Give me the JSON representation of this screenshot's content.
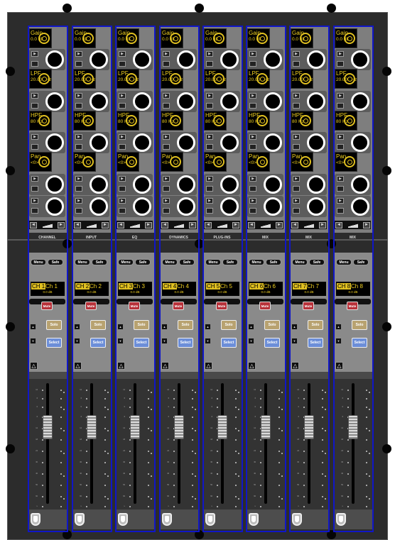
{
  "colors": {
    "accent_yellow": "#f0d020",
    "strip_outline": "#1016c8",
    "mute": "#b8323a",
    "solo": "#b8a270",
    "select": "#6c8ed8",
    "frame": "#2c2c2c"
  },
  "icons": {
    "pan_left": "◄",
    "pan_right": "►",
    "attention": "△",
    "up": "▲",
    "down": "▼"
  },
  "strips": [
    {
      "section_label": "CHANNEL",
      "ch_num": "CH 1",
      "ch_name": "Ch 1",
      "gain_label": "Gain",
      "gain_value": "0.0 dB",
      "lpf_label": "LPF",
      "lpf_value": "20.00 kHz",
      "hpf_label": "HPF",
      "hpf_value": "80 Hz",
      "pan_label": "Pan",
      "pan_value": "<0>",
      "menu": "Menu",
      "safe": "Safe",
      "fader_db": "0.0 dB",
      "mute": "Mute",
      "solo": "Solo",
      "select": "Select"
    },
    {
      "section_label": "INPUT",
      "ch_num": "CH 2",
      "ch_name": "Ch 2",
      "gain_label": "Gain",
      "gain_value": "0.0 dB",
      "lpf_label": "LPF",
      "lpf_value": "20.00 kHz",
      "hpf_label": "HPF",
      "hpf_value": "80 Hz",
      "pan_label": "Pan",
      "pan_value": "<0>",
      "menu": "Menu",
      "safe": "Safe",
      "fader_db": "0.0 dB",
      "mute": "Mute",
      "solo": "Solo",
      "select": "Select"
    },
    {
      "section_label": "EQ",
      "ch_num": "CH 3",
      "ch_name": "Ch 3",
      "gain_label": "Gain",
      "gain_value": "0.0 dB",
      "lpf_label": "LPF",
      "lpf_value": "20.00 kHz",
      "hpf_label": "HPF",
      "hpf_value": "80 Hz",
      "pan_label": "Pan",
      "pan_value": "<0>",
      "menu": "Menu",
      "safe": "Safe",
      "fader_db": "0.0 dB",
      "mute": "Mute",
      "solo": "Solo",
      "select": "Select"
    },
    {
      "section_label": "DYNAMICS",
      "ch_num": "CH 4",
      "ch_name": "Ch 4",
      "gain_label": "Gain",
      "gain_value": "0.0 dB",
      "lpf_label": "LPF",
      "lpf_value": "20.00 kHz",
      "hpf_label": "HPF",
      "hpf_value": "80 Hz",
      "pan_label": "Pan",
      "pan_value": "<0>",
      "menu": "Menu",
      "safe": "Safe",
      "fader_db": "0.0 dB",
      "mute": "Mute",
      "solo": "Solo",
      "select": "Select"
    },
    {
      "section_label": "PLUG-INS",
      "ch_num": "CH 5",
      "ch_name": "Ch 5",
      "gain_label": "Gain",
      "gain_value": "0.0 dB",
      "lpf_label": "LPF",
      "lpf_value": "20.00 kHz",
      "hpf_label": "HPF",
      "hpf_value": "80 Hz",
      "pan_label": "Pan",
      "pan_value": "<0>",
      "menu": "Menu",
      "safe": "Safe",
      "fader_db": "0.0 dB",
      "mute": "Mute",
      "solo": "Solo",
      "select": "Select"
    },
    {
      "section_label": "MIX",
      "ch_num": "CH 6",
      "ch_name": "Ch 6",
      "gain_label": "Gain",
      "gain_value": "0.0 dB",
      "lpf_label": "LPF",
      "lpf_value": "20.00 kHz",
      "hpf_label": "HPF",
      "hpf_value": "80 Hz",
      "pan_label": "Pan",
      "pan_value": "<0>",
      "menu": "Menu",
      "safe": "Safe",
      "fader_db": "0.0 dB",
      "mute": "Mute",
      "solo": "Solo",
      "select": "Select"
    },
    {
      "section_label": "MIX",
      "ch_num": "CH 7",
      "ch_name": "Ch 7",
      "gain_label": "Gain",
      "gain_value": "0.0 dB",
      "lpf_label": "LPF",
      "lpf_value": "20.00 kHz",
      "hpf_label": "HPF",
      "hpf_value": "80 Hz",
      "pan_label": "Pan",
      "pan_value": "<0>",
      "menu": "Menu",
      "safe": "Safe",
      "fader_db": "0.0 dB",
      "mute": "Mute",
      "solo": "Solo",
      "select": "Select"
    },
    {
      "section_label": "MIX",
      "ch_num": "CH 8",
      "ch_name": "Ch 8",
      "gain_label": "Gain",
      "gain_value": "0.0 dB",
      "lpf_label": "LPF",
      "lpf_value": "20.00 kHz",
      "hpf_label": "HPF",
      "hpf_value": "80 Hz",
      "pan_label": "Pan",
      "pan_value": "<0>",
      "menu": "Menu",
      "safe": "Safe",
      "fader_db": "0.0 dB",
      "mute": "Mute",
      "solo": "Solo",
      "select": "Select"
    }
  ]
}
